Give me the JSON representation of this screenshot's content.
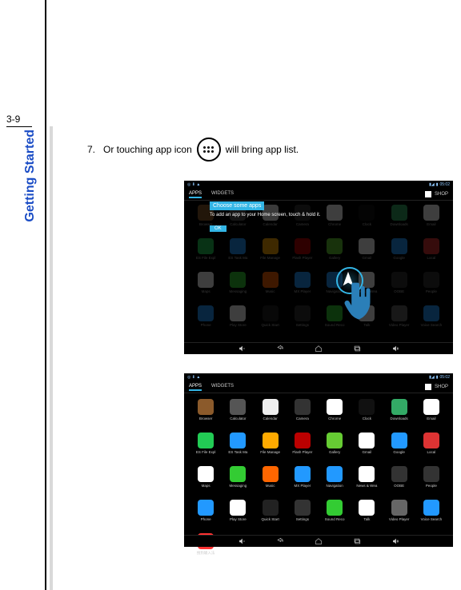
{
  "page_number": "3-9",
  "side_title": "Getting Started",
  "step": {
    "number": "7.",
    "text_before": "Or touching app icon",
    "text_after": "will bring app list."
  },
  "screenshot1": {
    "time": "05:02",
    "tabs": {
      "apps": "APPS",
      "widgets": "WIDGETS"
    },
    "shop": "SHOP",
    "tooltip_title": "Choose some apps",
    "tooltip_sub": "To add an app to your Home screen, touch & hold it.",
    "ok": "OK",
    "apps": [
      {
        "l": "Browser",
        "c": "c-brown"
      },
      {
        "l": "Calculator",
        "c": "c-gray"
      },
      {
        "l": "Calendar",
        "c": "c-cal"
      },
      {
        "l": "Camera",
        "c": "c-cam"
      },
      {
        "l": "Chrome",
        "c": "c-chr"
      },
      {
        "l": "Clock",
        "c": "c-clk"
      },
      {
        "l": "Downloads",
        "c": "c-dl"
      },
      {
        "l": "Email",
        "c": "c-mail"
      },
      {
        "l": "ES File Expl",
        "c": "c-es"
      },
      {
        "l": "ES Task Ma",
        "c": "c-tm"
      },
      {
        "l": "File Manage",
        "c": "c-fm"
      },
      {
        "l": "Flash Player",
        "c": "c-fp"
      },
      {
        "l": "Gallery",
        "c": "c-gal"
      },
      {
        "l": "Gmail",
        "c": "c-gm"
      },
      {
        "l": "Google",
        "c": "c-goo"
      },
      {
        "l": "Local",
        "c": "c-loc"
      },
      {
        "l": "Maps",
        "c": "c-map"
      },
      {
        "l": "Messaging",
        "c": "c-msg"
      },
      {
        "l": "Music",
        "c": "c-mus"
      },
      {
        "l": "MX Player",
        "c": "c-mx"
      },
      {
        "l": "Navigation",
        "c": "c-nav"
      },
      {
        "l": "News & Wea",
        "c": "c-nw"
      },
      {
        "l": "OOBE",
        "c": "c-oobe"
      },
      {
        "l": "People",
        "c": "c-ppl"
      },
      {
        "l": "Phone",
        "c": "c-ph"
      },
      {
        "l": "Play Store",
        "c": "c-ps"
      },
      {
        "l": "Quick Start",
        "c": "c-qs"
      },
      {
        "l": "Settings",
        "c": "c-set"
      },
      {
        "l": "Sound Reco",
        "c": "c-sr"
      },
      {
        "l": "Talk",
        "c": "c-tk"
      },
      {
        "l": "Video Player",
        "c": "c-vp"
      },
      {
        "l": "Voice Search",
        "c": "c-vs"
      }
    ]
  },
  "screenshot2": {
    "time": "05:02",
    "tabs": {
      "apps": "APPS",
      "widgets": "WIDGETS"
    },
    "shop": "SHOP",
    "apps": [
      {
        "l": "Browser",
        "c": "c-brown"
      },
      {
        "l": "Calculator",
        "c": "c-gray"
      },
      {
        "l": "Calendar",
        "c": "c-cal"
      },
      {
        "l": "Camera",
        "c": "c-cam"
      },
      {
        "l": "Chrome",
        "c": "c-chr"
      },
      {
        "l": "Clock",
        "c": "c-clk"
      },
      {
        "l": "Downloads",
        "c": "c-dl"
      },
      {
        "l": "Email",
        "c": "c-mail"
      },
      {
        "l": "ES File Expl",
        "c": "c-es"
      },
      {
        "l": "ES Task Ma",
        "c": "c-tm"
      },
      {
        "l": "File Manage",
        "c": "c-fm"
      },
      {
        "l": "Flash Player",
        "c": "c-fp"
      },
      {
        "l": "Gallery",
        "c": "c-gal"
      },
      {
        "l": "Gmail",
        "c": "c-gm"
      },
      {
        "l": "Google",
        "c": "c-goo"
      },
      {
        "l": "Local",
        "c": "c-loc"
      },
      {
        "l": "Maps",
        "c": "c-map"
      },
      {
        "l": "Messaging",
        "c": "c-msg"
      },
      {
        "l": "Music",
        "c": "c-mus"
      },
      {
        "l": "MX Player",
        "c": "c-mx"
      },
      {
        "l": "Navigation",
        "c": "c-nav"
      },
      {
        "l": "News & Wea",
        "c": "c-nw"
      },
      {
        "l": "OOBE",
        "c": "c-oobe"
      },
      {
        "l": "People",
        "c": "c-ppl"
      },
      {
        "l": "Phone",
        "c": "c-ph"
      },
      {
        "l": "Play Store",
        "c": "c-ps"
      },
      {
        "l": "Quick Start",
        "c": "c-qs"
      },
      {
        "l": "Settings",
        "c": "c-set"
      },
      {
        "l": "Sound Reco",
        "c": "c-sr"
      },
      {
        "l": "Talk",
        "c": "c-tk"
      },
      {
        "l": "Video Player",
        "c": "c-vp"
      },
      {
        "l": "Voice Search",
        "c": "c-vs"
      },
      {
        "l": "搜狗输入法",
        "c": "c-sg"
      }
    ]
  }
}
